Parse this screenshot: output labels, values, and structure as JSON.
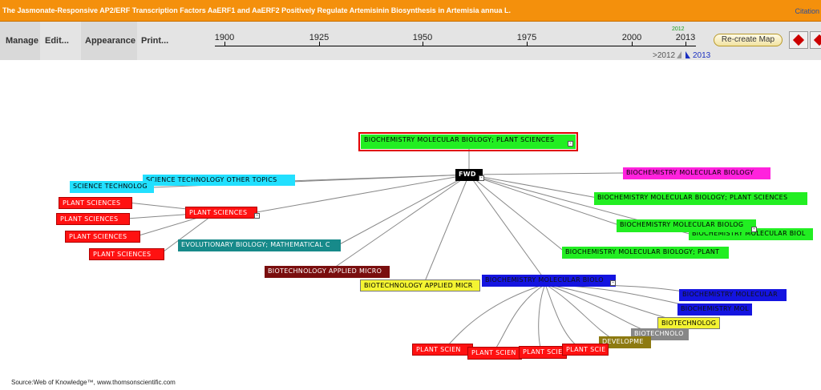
{
  "header": {
    "title": "The Jasmonate-Responsive AP2/ERF Transcription Factors AaERF1 and AaERF2 Positively Regulate Artemisinin Biosynthesis in Artemisia annua L.",
    "citation_link": "Citation"
  },
  "menu": [
    "Manage",
    "Edit...",
    "Appearance",
    "Print..."
  ],
  "timeline": {
    "ticks": [
      "1900",
      "1925",
      "1950",
      "1975",
      "2000",
      "2013"
    ],
    "marker_label": "2012",
    "range_left": ">2012",
    "range_right": "2013"
  },
  "recreate_button": "Re-create Map",
  "center_node": "FWD",
  "nodes": {
    "top_box": "BIOCHEMISTRY MOLECULAR BIOLOGY; PLANT SCIENCES",
    "sci_tech_other": "SCIENCE TECHNOLOGY OTHER TOPICS",
    "sci_tech": "SCIENCE TECHNOLOG",
    "plant_sciences_hub": "PLANT SCIENCES",
    "ps1": "PLANT SCIENCES",
    "ps2": "PLANT SCIENCES",
    "ps3": "PLANT SCIENCES",
    "ps4": "PLANT SCIENCES",
    "evo_bio": "EVOLUTIONARY BIOLOGY; MATHEMATICAL C",
    "biotech_micro_maroon": "BIOTECHNOLOGY APPLIED MICRO",
    "biotech_micro_yellow": "BIOTECHNOLOGY APPLIED MICR",
    "bmb_magenta": "BIOCHEMISTRY MOLECULAR BIOLOGY",
    "bmb_ps_green": "BIOCHEMISTRY MOLECULAR BIOLOGY; PLANT SCIENCES",
    "bmb_green_a": "BIOCHEMISTRY MOLECULAR BIOLOG",
    "bmb_green_b": "BIOCHEMISTRY MOLECULAR BIOL",
    "bmb_plant_green": "BIOCHEMISTRY MOLECULAR BIOLOGY; PLANT",
    "bmb_blue_hub": "BIOCHEMISTRY MOLECULAR BIOLO",
    "bmb_blue_a": "BIOCHEMISTRY MOLECULAR",
    "bmb_blue_b": "BIOCHEMISTRY MOL",
    "biotech_yellow_small": "BIOTECHNOLOG",
    "biotech_gray": "BIOTECHNOLO",
    "develop_olive": "DEVELOPME",
    "bottom_ps1": "PLANT SCIEN",
    "bottom_ps2": "PLANT SCIEN",
    "bottom_ps3": "PLANT SCIE",
    "bottom_ps4": "PLANT SCIE"
  },
  "footer": "Source:Web of Knowledge™, www.thomsonscientific.com",
  "colors": {
    "header": "#f4900c",
    "red": "#ff1111",
    "green": "#22ee22",
    "cyan": "#22e0ff",
    "magenta": "#ff22dd",
    "blue": "#1414e0",
    "teal": "#178a8a",
    "maroon": "#7a0e0e",
    "yellow": "#f4f432"
  }
}
